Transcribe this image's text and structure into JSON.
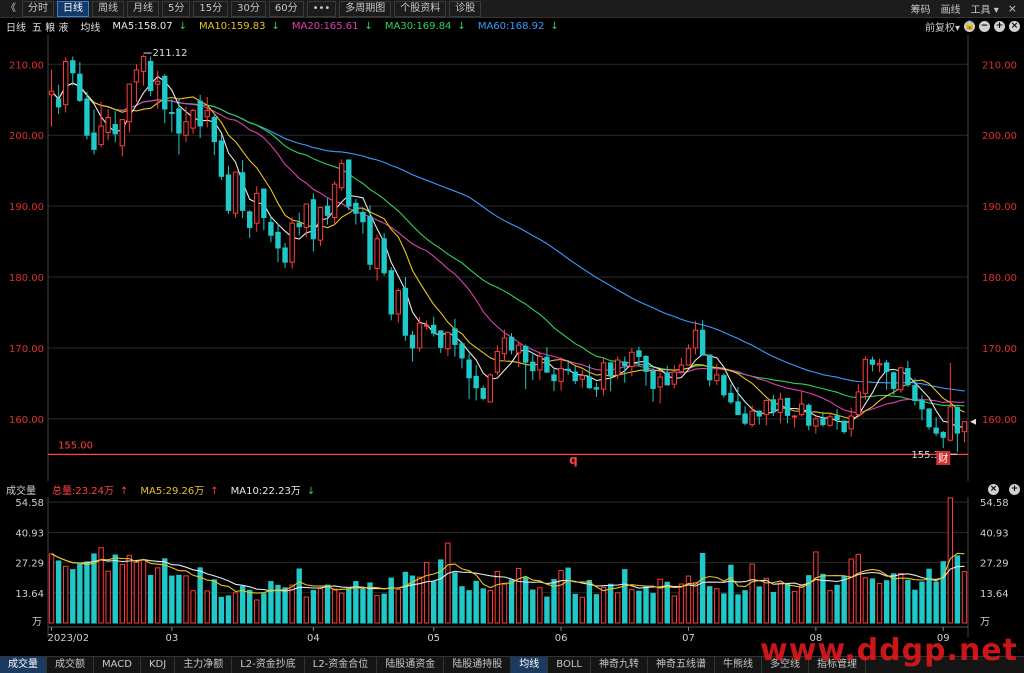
{
  "toolbar": {
    "back_glyph": "《",
    "tabs": [
      {
        "label": "分时",
        "active": false
      },
      {
        "label": "日线",
        "active": true
      },
      {
        "label": "周线",
        "active": false
      },
      {
        "label": "月线",
        "active": false
      },
      {
        "label": "5分",
        "active": false
      },
      {
        "label": "15分",
        "active": false
      },
      {
        "label": "30分",
        "active": false
      },
      {
        "label": "60分",
        "active": false
      },
      {
        "label": "•••",
        "active": false
      },
      {
        "label": "多周期图",
        "active": false
      },
      {
        "label": "个股资料",
        "active": false
      },
      {
        "label": "诊股",
        "active": false
      }
    ],
    "right": {
      "chips": "筹码",
      "draw": "画线",
      "tools": "工具",
      "tools_arrow": "▾"
    }
  },
  "legend": {
    "period": "日线",
    "stock_name": "五 粮 液",
    "avg_label": "均线",
    "ma": [
      {
        "text": "MA5:158.07",
        "arrow": "↓",
        "color": "#e8e8e8"
      },
      {
        "text": "MA10:159.83",
        "arrow": "↓",
        "color": "#e8c51e"
      },
      {
        "text": "MA20:165.61",
        "arrow": "↓",
        "color": "#e040b0"
      },
      {
        "text": "MA30:169.84",
        "arrow": "↓",
        "color": "#2fd15c"
      },
      {
        "text": "MA60:168.92",
        "arrow": "↓",
        "color": "#3d9bff"
      }
    ],
    "adjust": "前复权",
    "adjust_arrow": "▾"
  },
  "volume_panel": {
    "title": "成交量",
    "total": {
      "text": "总量:23.24万",
      "arrow": "↑",
      "color": "#ff4040"
    },
    "ma5": {
      "text": "MA5:29.26万",
      "arrow": "↑",
      "color": "#e8c51e"
    },
    "ma10": {
      "text": "MA10:22.23万",
      "arrow": "↓",
      "color": "#e8e8e8"
    }
  },
  "bottom_tabs": [
    {
      "label": "成交量",
      "active": true
    },
    {
      "label": "成交额",
      "active": false
    },
    {
      "label": "MACD",
      "active": false
    },
    {
      "label": "KDJ",
      "active": false
    },
    {
      "label": "主力净额",
      "active": false
    },
    {
      "label": "L2-资金抄底",
      "active": false
    },
    {
      "label": "L2-资金合位",
      "active": false
    },
    {
      "label": "陆股通资金",
      "active": false
    },
    {
      "label": "陆股通持股",
      "active": false
    },
    {
      "label": "均线",
      "active": true
    },
    {
      "label": "BOLL",
      "active": false
    },
    {
      "label": "神奇九转",
      "active": false
    },
    {
      "label": "神奇五线谱",
      "active": false
    },
    {
      "label": "牛熊线",
      "active": false
    },
    {
      "label": "多空线",
      "active": false
    },
    {
      "label": "指标管理",
      "active": false
    }
  ],
  "watermark": "www.ddgp.net",
  "colors": {
    "up": "#ff3b3b",
    "down": "#20c8c8",
    "ma5": "#e8e8e8",
    "ma10": "#e8c51e",
    "ma20": "#e040b0",
    "ma30": "#2fd15c",
    "ma60": "#3d9bff",
    "axis_text": "#e03030",
    "grid": "#2a2a2a"
  },
  "chart_data": {
    "type": "candlestick",
    "price_axis": {
      "ylim": [
        153.5,
        213
      ],
      "ticks": [
        "210.00",
        "200.00",
        "190.00",
        "180.00",
        "170.00",
        "160.00"
      ]
    },
    "volume_axis": {
      "ylim": [
        0,
        56
      ],
      "ticks": [
        "54.58",
        "40.93",
        "27.29",
        "13.64"
      ],
      "unit": "万"
    },
    "x_labels": [
      "2023/02",
      "03",
      "04",
      "05",
      "06",
      "07",
      "08",
      "09"
    ],
    "x_label_index": [
      0,
      17,
      37,
      54,
      72,
      90,
      108,
      126
    ],
    "annotations": {
      "high": "211.12",
      "low": "155.33",
      "support_value": 155.0,
      "support_label": "155.00",
      "event_q": "q",
      "event_cai": "财"
    },
    "candles": [
      [
        205.7,
        206.2,
        201.2,
        209.3,
        31.2
      ],
      [
        205.1,
        204.0,
        203.0,
        207.1,
        28.0
      ],
      [
        204.3,
        210.4,
        203.2,
        211.0,
        25.6
      ],
      [
        210.5,
        208.8,
        207.0,
        211.1,
        24.1
      ],
      [
        208.6,
        204.9,
        204.7,
        210.3,
        26.6
      ],
      [
        205.1,
        200.0,
        199.4,
        206.1,
        27.6
      ],
      [
        200.3,
        198.0,
        197.3,
        203.6,
        31.2
      ],
      [
        198.7,
        201.3,
        198.3,
        204.7,
        34.0
      ],
      [
        200.4,
        202.5,
        199.3,
        203.7,
        23.4
      ],
      [
        201.5,
        200.2,
        199.0,
        203.4,
        30.7
      ],
      [
        198.5,
        202.2,
        197.0,
        202.3,
        26.4
      ],
      [
        201.9,
        207.2,
        200.4,
        207.2,
        30.6
      ],
      [
        207.5,
        209.2,
        204.7,
        210.0,
        27.4
      ],
      [
        209.0,
        211.1,
        207.0,
        211.3,
        28.4
      ],
      [
        210.4,
        206.3,
        205.5,
        211.1,
        21.5
      ],
      [
        207.2,
        207.6,
        203.7,
        209.1,
        24.9
      ],
      [
        208.3,
        203.7,
        201.7,
        208.6,
        29.0
      ],
      [
        203.2,
        203.1,
        200.4,
        205.1,
        21.2
      ],
      [
        203.7,
        200.3,
        197.3,
        205.0,
        21.5
      ],
      [
        200.0,
        201.9,
        199.0,
        204.0,
        21.3
      ],
      [
        201.0,
        203.5,
        200.2,
        203.7,
        14.6
      ],
      [
        204.8,
        201.3,
        199.6,
        205.7,
        24.9
      ],
      [
        202.6,
        203.5,
        201.1,
        205.4,
        14.5
      ],
      [
        202.5,
        199.1,
        197.2,
        203.1,
        19.5
      ],
      [
        199.2,
        194.2,
        193.7,
        200.2,
        11.6
      ],
      [
        194.4,
        189.4,
        188.9,
        195.7,
        12.2
      ],
      [
        189.0,
        194.8,
        188.4,
        194.8,
        13.6
      ],
      [
        194.7,
        189.4,
        188.3,
        196.5,
        16.5
      ],
      [
        189.2,
        187.0,
        185.5,
        189.4,
        14.8
      ],
      [
        187.6,
        191.8,
        186.4,
        192.8,
        10.4
      ],
      [
        192.4,
        188.4,
        186.6,
        192.5,
        13.2
      ],
      [
        187.7,
        185.9,
        184.9,
        188.5,
        18.7
      ],
      [
        186.3,
        184.1,
        182.1,
        187.5,
        17.0
      ],
      [
        184.1,
        182.1,
        181.3,
        184.8,
        15.9
      ],
      [
        182.1,
        187.6,
        181.2,
        188.4,
        17.1
      ],
      [
        187.6,
        187.1,
        185.9,
        189.1,
        24.4
      ],
      [
        187.0,
        190.3,
        185.6,
        190.3,
        11.7
      ],
      [
        190.9,
        185.4,
        183.6,
        191.8,
        14.7
      ],
      [
        185.2,
        189.8,
        184.4,
        189.9,
        15.5
      ],
      [
        190.0,
        188.7,
        187.4,
        191.1,
        17.1
      ],
      [
        188.4,
        193.1,
        187.4,
        193.5,
        15.4
      ],
      [
        192.6,
        196.0,
        192.2,
        196.6,
        13.5
      ],
      [
        196.5,
        190.0,
        189.4,
        196.6,
        15.5
      ],
      [
        190.4,
        189.0,
        187.4,
        191.0,
        18.7
      ],
      [
        189.1,
        187.8,
        186.1,
        189.8,
        15.1
      ],
      [
        188.5,
        181.8,
        181.0,
        190.1,
        18.1
      ],
      [
        181.2,
        185.4,
        179.5,
        186.0,
        12.4
      ],
      [
        185.4,
        180.6,
        180.2,
        186.2,
        13.0
      ],
      [
        180.9,
        174.8,
        173.9,
        181.4,
        20.3
      ],
      [
        174.8,
        178.1,
        173.6,
        178.4,
        15.2
      ],
      [
        178.4,
        171.8,
        171.0,
        180.0,
        22.9
      ],
      [
        171.8,
        170.0,
        168.1,
        172.4,
        21.2
      ],
      [
        170.0,
        173.5,
        169.5,
        174.4,
        20.7
      ],
      [
        173.1,
        173.2,
        172.6,
        173.9,
        27.3
      ],
      [
        173.2,
        172.1,
        171.6,
        174.4,
        18.6
      ],
      [
        172.4,
        170.1,
        169.3,
        172.5,
        28.5
      ],
      [
        169.9,
        172.2,
        168.9,
        172.3,
        36.1
      ],
      [
        172.7,
        170.5,
        168.8,
        174.1,
        22.6
      ],
      [
        170.6,
        168.6,
        167.1,
        170.9,
        16.4
      ],
      [
        168.3,
        165.8,
        162.8,
        169.2,
        14.6
      ],
      [
        166.0,
        164.4,
        162.6,
        167.6,
        18.8
      ],
      [
        164.3,
        162.9,
        162.6,
        164.7,
        15.4
      ],
      [
        162.4,
        166.2,
        162.3,
        166.4,
        14.7
      ],
      [
        166.6,
        169.5,
        166.2,
        170.4,
        23.3
      ],
      [
        169.2,
        171.4,
        168.1,
        172.6,
        17.5
      ],
      [
        171.5,
        169.7,
        169.1,
        172.1,
        19.4
      ],
      [
        169.3,
        170.4,
        167.3,
        170.7,
        24.6
      ],
      [
        170.2,
        168.0,
        164.2,
        170.5,
        20.5
      ],
      [
        168.0,
        166.8,
        165.5,
        169.3,
        14.9
      ],
      [
        166.9,
        168.8,
        165.5,
        169.5,
        15.9
      ],
      [
        168.7,
        166.6,
        166.5,
        170.1,
        11.7
      ],
      [
        166.2,
        165.4,
        163.9,
        167.3,
        19.6
      ],
      [
        165.3,
        167.1,
        164.0,
        168.7,
        23.7
      ],
      [
        167.0,
        166.9,
        166.2,
        168.3,
        24.8
      ],
      [
        166.6,
        165.4,
        164.9,
        167.5,
        12.9
      ],
      [
        165.6,
        166.1,
        164.4,
        166.9,
        11.6
      ],
      [
        165.9,
        164.4,
        164.2,
        167.7,
        19.2
      ],
      [
        164.4,
        164.2,
        163.1,
        165.1,
        12.8
      ],
      [
        164.2,
        167.9,
        163.3,
        168.7,
        16.1
      ],
      [
        167.9,
        166.1,
        163.9,
        168.0,
        17.5
      ],
      [
        166.2,
        168.3,
        165.6,
        168.8,
        13.6
      ],
      [
        168.0,
        167.5,
        165.1,
        168.8,
        24.1
      ],
      [
        167.4,
        169.4,
        166.0,
        170.0,
        15.1
      ],
      [
        169.6,
        168.8,
        167.4,
        170.2,
        14.4
      ],
      [
        168.8,
        166.7,
        164.7,
        169.0,
        16.3
      ],
      [
        166.7,
        164.3,
        162.4,
        167.2,
        13.3
      ],
      [
        164.5,
        165.9,
        162.2,
        166.5,
        19.8
      ],
      [
        166.4,
        164.8,
        164.7,
        167.5,
        18.4
      ],
      [
        164.9,
        166.6,
        164.3,
        167.6,
        12.2
      ],
      [
        166.7,
        167.6,
        166.5,
        168.6,
        17.6
      ],
      [
        167.6,
        169.9,
        167.5,
        170.5,
        21.2
      ],
      [
        170.0,
        172.5,
        169.1,
        173.8,
        18.3
      ],
      [
        172.5,
        169.0,
        168.9,
        173.9,
        31.4
      ],
      [
        169.0,
        165.5,
        164.6,
        169.1,
        16.4
      ],
      [
        165.4,
        166.2,
        164.8,
        167.8,
        15.5
      ],
      [
        166.1,
        163.4,
        163.0,
        166.4,
        13.1
      ],
      [
        163.6,
        162.4,
        162.1,
        164.9,
        26.1
      ],
      [
        162.4,
        160.6,
        160.6,
        164.5,
        12.7
      ],
      [
        160.7,
        159.4,
        159.1,
        161.8,
        14.6
      ],
      [
        159.2,
        161.1,
        158.8,
        161.9,
        26.6
      ],
      [
        161.1,
        160.4,
        159.2,
        161.2,
        16.3
      ],
      [
        160.6,
        162.6,
        159.1,
        162.8,
        20.2
      ],
      [
        162.7,
        161.0,
        160.4,
        163.4,
        13.8
      ],
      [
        160.9,
        162.8,
        159.4,
        163.7,
        18.0
      ],
      [
        162.9,
        160.5,
        159.4,
        162.9,
        17.6
      ],
      [
        160.3,
        160.4,
        158.8,
        160.6,
        14.2
      ],
      [
        160.6,
        162.1,
        160.3,
        163.9,
        16.8
      ],
      [
        161.9,
        159.1,
        158.4,
        162.2,
        21.4
      ],
      [
        159.0,
        160.0,
        157.9,
        160.4,
        32.1
      ],
      [
        160.0,
        159.2,
        158.9,
        161.0,
        22.0
      ],
      [
        159.1,
        160.3,
        158.9,
        160.8,
        14.6
      ],
      [
        160.4,
        159.9,
        158.5,
        161.4,
        17.0
      ],
      [
        159.7,
        158.2,
        157.9,
        159.7,
        20.9
      ],
      [
        158.6,
        160.4,
        157.5,
        161.6,
        28.9
      ],
      [
        160.6,
        163.8,
        160.3,
        164.9,
        31.0
      ],
      [
        163.6,
        168.4,
        162.7,
        168.8,
        20.4
      ],
      [
        168.3,
        167.7,
        166.7,
        168.8,
        19.9
      ],
      [
        167.6,
        167.8,
        166.6,
        168.5,
        17.9
      ],
      [
        167.9,
        166.7,
        164.1,
        168.3,
        19.1
      ],
      [
        166.5,
        164.3,
        163.4,
        166.7,
        22.2
      ],
      [
        164.1,
        167.2,
        163.7,
        167.3,
        22.4
      ],
      [
        167.1,
        164.8,
        164.5,
        168.2,
        19.3
      ],
      [
        164.7,
        162.6,
        161.9,
        165.7,
        14.8
      ],
      [
        162.6,
        161.4,
        159.8,
        163.4,
        18.5
      ],
      [
        161.4,
        158.9,
        158.5,
        161.5,
        24.3
      ],
      [
        158.7,
        158.0,
        157.6,
        160.2,
        18.5
      ],
      [
        158.1,
        157.4,
        155.9,
        158.3,
        27.7
      ],
      [
        157.0,
        161.7,
        156.8,
        167.9,
        56.5
      ],
      [
        161.6,
        158.0,
        155.3,
        161.8,
        30.3
      ],
      [
        158.2,
        159.6,
        156.7,
        159.7,
        23.2
      ]
    ]
  }
}
